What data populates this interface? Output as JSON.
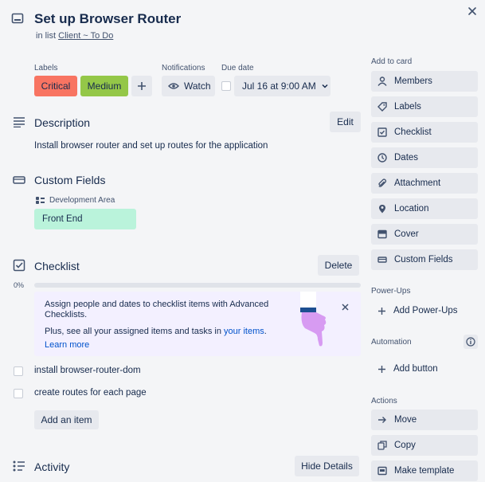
{
  "header": {
    "title": "Set up Browser Router",
    "in_list_prefix": "in list",
    "list_name": "Client ~ To Do"
  },
  "labels_section": {
    "heading": "Labels",
    "labels": [
      {
        "text": "Critical",
        "color": "#f87462"
      },
      {
        "text": "Medium",
        "color": "#94c748"
      }
    ],
    "add_icon": "plus-icon"
  },
  "notifications": {
    "heading": "Notifications",
    "watch_label": "Watch"
  },
  "due_date": {
    "heading": "Due date",
    "value": "Jul 16 at 9:00 AM"
  },
  "description": {
    "title": "Description",
    "edit_label": "Edit",
    "text": "Install browser router and set up routes for the application"
  },
  "custom_fields": {
    "title": "Custom Fields",
    "field_name": "Development Area",
    "field_value": "Front End",
    "field_color": "#baf3db"
  },
  "checklist": {
    "title": "Checklist",
    "delete_label": "Delete",
    "progress_text": "0%",
    "progress": 0,
    "promo": {
      "text1": "Assign people and dates to checklist items with Advanced Checklists.",
      "text2_prefix": "Plus, see all your assigned items and tasks in ",
      "text2_link": "your items",
      "text2_suffix": ".",
      "learn_more": "Learn more"
    },
    "items": [
      {
        "text": "install browser-router-dom"
      },
      {
        "text": "create routes for each page"
      }
    ],
    "add_item_label": "Add an item"
  },
  "activity": {
    "title": "Activity",
    "hide_details_label": "Hide Details"
  },
  "sidebar": {
    "add_to_card_heading": "Add to card",
    "add_to_card": [
      {
        "label": "Members",
        "icon": "person-icon"
      },
      {
        "label": "Labels",
        "icon": "tag-icon"
      },
      {
        "label": "Checklist",
        "icon": "checkbox-icon"
      },
      {
        "label": "Dates",
        "icon": "clock-icon"
      },
      {
        "label": "Attachment",
        "icon": "paperclip-icon"
      },
      {
        "label": "Location",
        "icon": "pin-icon"
      },
      {
        "label": "Cover",
        "icon": "cover-icon"
      },
      {
        "label": "Custom Fields",
        "icon": "field-icon"
      }
    ],
    "powerups_heading": "Power-Ups",
    "add_powerups_label": "Add Power-Ups",
    "automation_heading": "Automation",
    "add_button_label": "Add button",
    "actions_heading": "Actions",
    "actions": [
      {
        "label": "Move",
        "icon": "arrow-right-icon"
      },
      {
        "label": "Copy",
        "icon": "copy-icon"
      },
      {
        "label": "Make template",
        "icon": "template-icon"
      }
    ]
  }
}
